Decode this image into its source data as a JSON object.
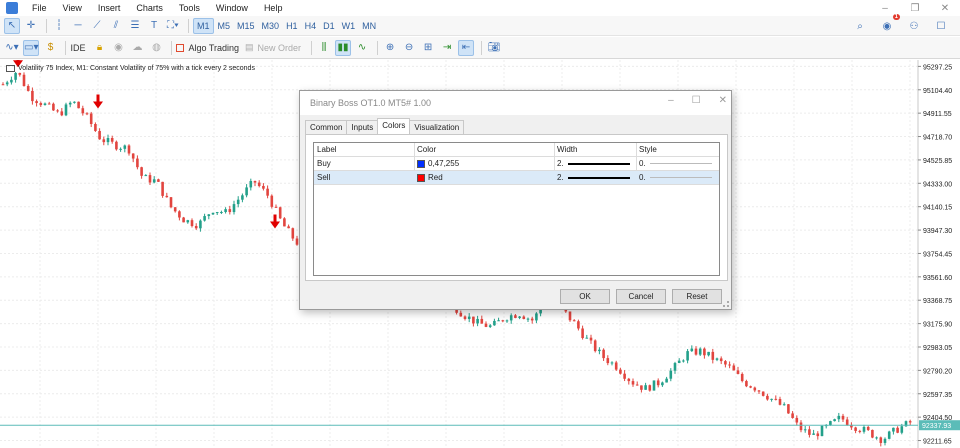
{
  "menu": [
    "File",
    "View",
    "Insert",
    "Charts",
    "Tools",
    "Window",
    "Help"
  ],
  "timeframes": [
    {
      "label": "M1",
      "active": true
    },
    {
      "label": "M5",
      "active": false
    },
    {
      "label": "M15",
      "active": false
    },
    {
      "label": "M30",
      "active": false
    },
    {
      "label": "H1",
      "active": false
    },
    {
      "label": "H4",
      "active": false
    },
    {
      "label": "D1",
      "active": false
    },
    {
      "label": "W1",
      "active": false
    },
    {
      "label": "MN",
      "active": false
    }
  ],
  "toolbar": {
    "ide_label": "IDE",
    "algo_trading_label": "Algo Trading",
    "new_order_label": "New Order",
    "notification_count": "1"
  },
  "chart": {
    "title": "Volatility 75 Index, M1:  Constant Volatility of 75% with a tick every 2 seconds",
    "price_labels": [
      "95297.25",
      "95104.40",
      "94911.55",
      "94718.70",
      "94525.85",
      "94333.00",
      "94140.15",
      "93947.30",
      "93754.45",
      "93561.60",
      "93368.75",
      "93175.90",
      "92983.05",
      "92790.20",
      "92597.35",
      "92404.50",
      "92211.65"
    ],
    "current_price": "92337.93",
    "colors": {
      "bull": "#23a08a",
      "bear": "#e2453f",
      "arrow": "#e00000",
      "current_line": "#5bbcb8"
    }
  },
  "chart_data": {
    "type": "candlestick",
    "title": "Volatility 75 Index, M1:  Constant Volatility of 75% with a tick every 2 seconds",
    "ylim": [
      92150,
      95350
    ],
    "y_ticks": [
      95297.25,
      95104.4,
      94911.55,
      94718.7,
      94525.85,
      94333.0,
      94140.15,
      93947.3,
      93754.45,
      93561.6,
      93368.75,
      93175.9,
      92983.05,
      92790.2,
      92597.35,
      92404.5,
      92211.65
    ],
    "current_price": 92337.93,
    "path_closes": [
      95150,
      95260,
      95050,
      94980,
      94900,
      95010,
      94880,
      94700,
      94650,
      94620,
      94380,
      94350,
      94140,
      94030,
      93990,
      94120,
      94090,
      94220,
      94350,
      94230,
      94000,
      93850,
      93780,
      93700,
      93760,
      93650,
      93780,
      93800,
      93730,
      93620,
      93500,
      93420,
      93350,
      93250,
      93180,
      93150,
      93230,
      93260,
      93200,
      93420,
      93300,
      93170,
      93020,
      92900,
      92820,
      92700,
      92640,
      92690,
      92800,
      92930,
      92950,
      92880,
      92820,
      92700,
      92640,
      92560,
      92480,
      92320,
      92250,
      92320,
      92400,
      92330,
      92280,
      92220,
      92300,
      92360
    ]
  },
  "dialog": {
    "title": "Binary Boss OT1.0 MT5# 1.00",
    "tabs": [
      "Common",
      "Inputs",
      "Colors",
      "Visualization"
    ],
    "active_tab": "Colors",
    "columns": [
      "Label",
      "Color",
      "Width",
      "Style"
    ],
    "rows": [
      {
        "label": "Buy",
        "color_name": "0,47,255",
        "color_hex": "#002fff",
        "width": "2.",
        "style": "0."
      },
      {
        "label": "Sell",
        "color_name": "Red",
        "color_hex": "#ff0000",
        "width": "2.",
        "style": "0."
      }
    ],
    "buttons": {
      "ok": "OK",
      "cancel": "Cancel",
      "reset": "Reset"
    }
  }
}
